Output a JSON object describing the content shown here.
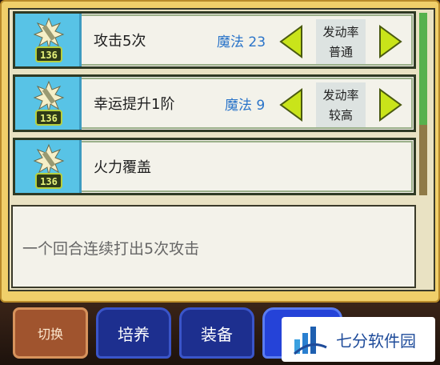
{
  "skills": [
    {
      "name": "攻击5次",
      "cost": "魔法 23",
      "rate_label": "发动率",
      "rate_value": "普通",
      "level_badge": "136"
    },
    {
      "name": "幸运提升1阶",
      "cost": "魔法 9",
      "rate_label": "发动率",
      "rate_value": "较高",
      "level_badge": "136"
    },
    {
      "name": "火力覆盖",
      "level_badge": "136"
    }
  ],
  "description": "一个回合连续打出5次攻击",
  "bottom_nav": {
    "switch_label": "切换",
    "train_label": "培养",
    "equip_label": "装备"
  },
  "watermark": {
    "brand": "七分软件园"
  },
  "colors": {
    "frame": "#f0cf6a",
    "icon_bg": "#58c3e6",
    "cost_text": "#2a74c9",
    "arrow": "#c9e41a",
    "scroll_thumb": "#57b14d"
  }
}
